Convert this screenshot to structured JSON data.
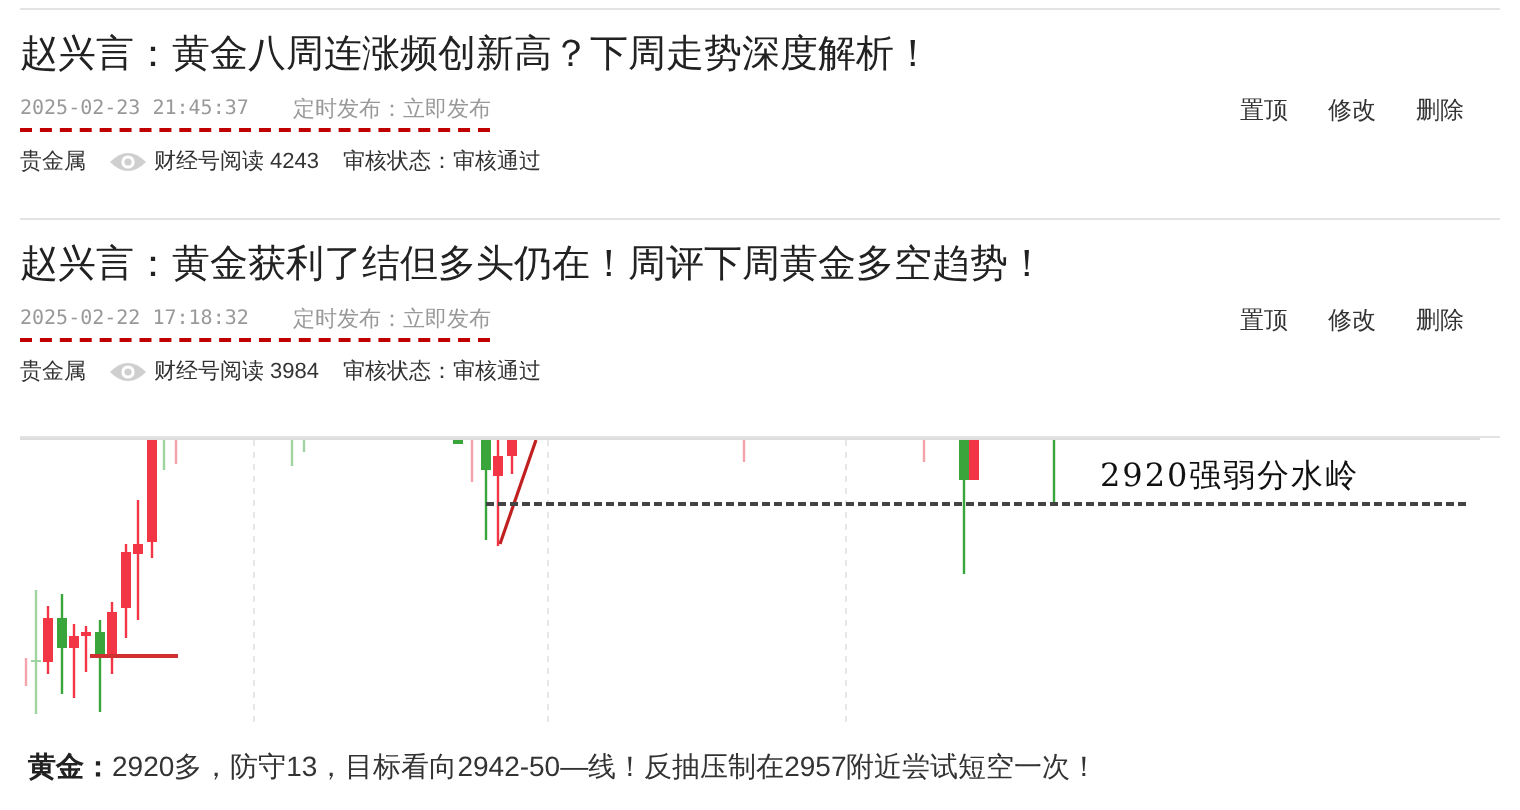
{
  "articles": [
    {
      "title": "赵兴言：黄金八周连涨频创新高？下周走势深度解析！",
      "time": "2025-02-23 21:45:37",
      "publish": "定时发布：立即发布",
      "actions": [
        "置顶",
        "修改",
        "删除"
      ],
      "category": "贵金属",
      "reads": "财经号阅读 4243",
      "review": "审核状态：审核通过"
    },
    {
      "title": "赵兴言：黄金获利了结但多头仍在！周评下周黄金多空趋势！",
      "time": "2025-02-22 17:18:32",
      "publish": "定时发布：立即发布",
      "actions": [
        "置顶",
        "修改",
        "删除"
      ],
      "category": "贵金属",
      "reads": "财经号阅读 3984",
      "review": "审核状态：审核通过"
    }
  ],
  "chart": {
    "annotation": "2920强弱分水岭"
  },
  "summary": "**黄金：**2920多，防守13，目标看向2942-50—线！反抽压制在2957附近尝试短空一次！"
}
